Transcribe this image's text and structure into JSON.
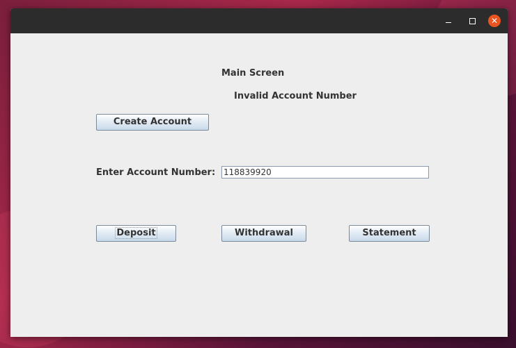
{
  "window": {
    "controls": {
      "minimize": "–",
      "maximize": "□",
      "close": "✕"
    }
  },
  "main": {
    "title": "Main Screen",
    "status_message": "Invalid Account Number",
    "create_account_label": "Create Account",
    "account_number_label": "Enter Account Number:",
    "account_number_value": "118839920",
    "deposit_label": "Deposit",
    "withdrawal_label": "Withdrawal",
    "statement_label": "Statement"
  },
  "colors": {
    "close_button": "#e95420",
    "titlebar": "#2c2c2c",
    "window_bg": "#eeeeee"
  }
}
